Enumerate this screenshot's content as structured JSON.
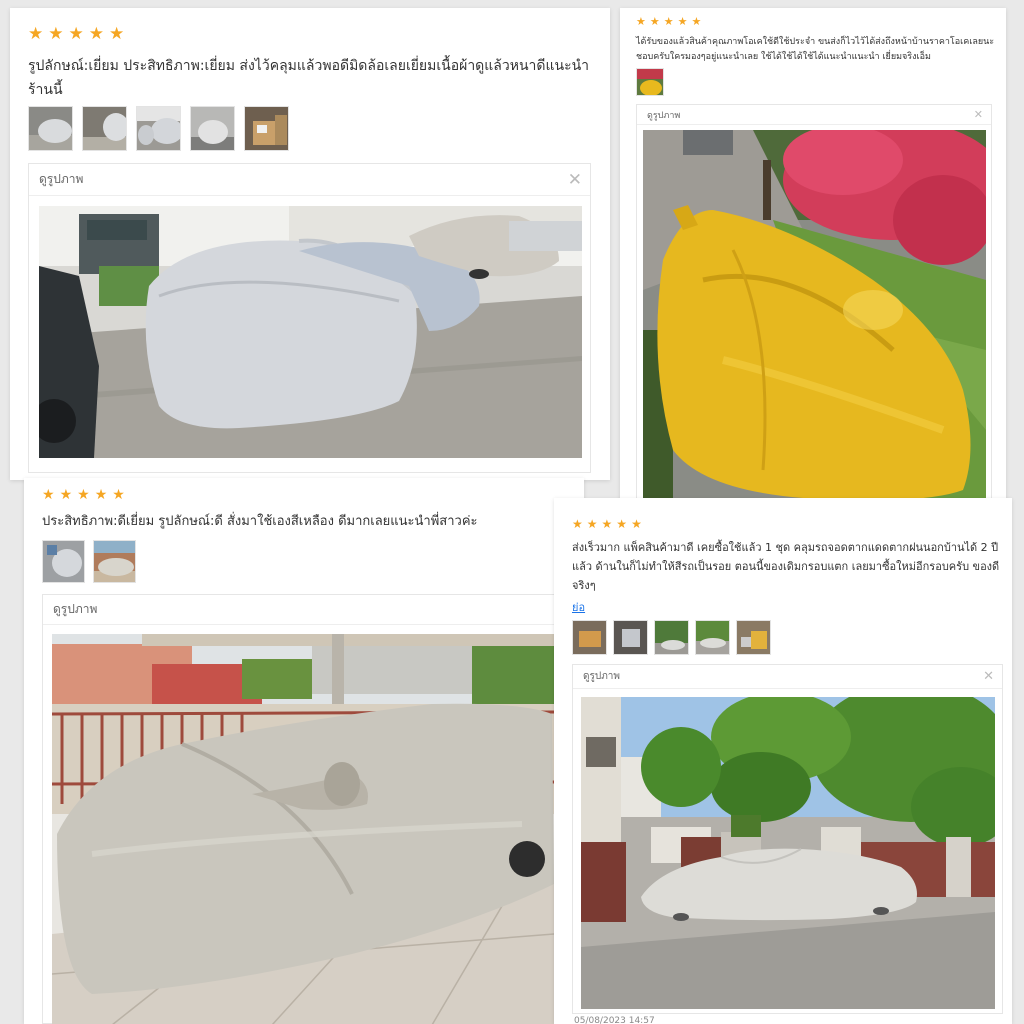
{
  "star_char": "★",
  "colors": {
    "star": "#f5a623",
    "link": "#1a73e8",
    "text": "#333333",
    "cover_silver": "#cfd2d6",
    "cover_yellow": "#e8b91e"
  },
  "reviews": [
    {
      "rating": 5,
      "text": "รูปลักษณ์:เยี่ยม ประสิทธิภาพ:เยี่ยม ส่งไว้คลุมแล้วพอดีมิดล้อเลยเยี่ยมเนื้อผ้าดูแล้วหนาดีแนะนำร้านนี้",
      "thumbnail_count": 5,
      "viewer_title": "ดูรูปภาพ",
      "close_icon": "✕"
    },
    {
      "rating": 5,
      "text": "ได้รับของแล้วสินค้าคุณภาพโอเคใช้ดีใช้ประจำ ขนส่งก็ไวไว้ได้ส่งถึงหน้าบ้านราคาโอเคเลยนะชอบครับใครมองๆอยู่แนะนำเลย ใช้ได้ใช้ได้ใช้ได้แนะนำแนะนำ เยี่ยมจริงเอ็ม",
      "thumbnail_count": 1,
      "viewer_title": "ดูรูปภาพ",
      "close_icon": "✕"
    },
    {
      "rating": 5,
      "text": "ประสิทธิภาพ:ดีเยี่ยม รูปลักษณ์:ดี สั่งมาใช้เองสีเหลือง ดีมากเลยแนะนำพี่สาวค่ะ",
      "thumbnail_count": 2,
      "viewer_title": "ดูรูปภาพ",
      "close_icon": "✕"
    },
    {
      "rating": 5,
      "text": "ส่งเร็วมาก แพ็คสินค้ามาดี เคยซื้อใช้แล้ว 1 ชุด คลุมรถจอดตากแดดตากฝนนอกบ้านได้ 2 ปีแล้ว ด้านในก็ไม่ทำให้สีรถเป็นรอย ตอนนี้ของเดิมกรอบแตก เลยมาซื้อใหม่อีกรอบครับ ของดีจริงๆ",
      "more_label": "ย่อ",
      "thumbnail_count": 5,
      "viewer_title": "ดูรูปภาพ",
      "close_icon": "✕",
      "timestamp": "05/08/2023 14:57"
    }
  ]
}
